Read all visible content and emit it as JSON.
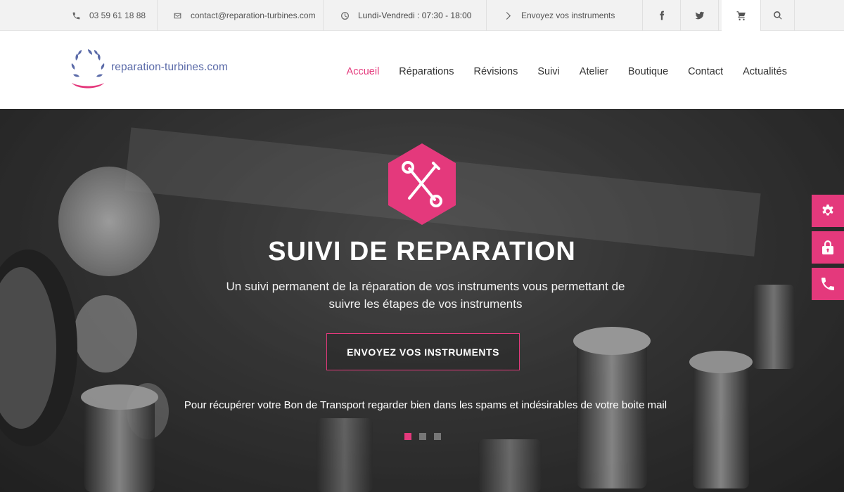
{
  "topbar": {
    "phone": "03 59 61 18 88",
    "email": "contact@reparation-turbines.com",
    "hours": "Lundi-Vendredi : 07:30 - 18:00",
    "send_link": "Envoyez vos instruments",
    "icons": [
      "phone-icon",
      "mail-icon",
      "clock-icon",
      "chevron-right-icon",
      "facebook-icon",
      "twitter-icon",
      "cart-icon",
      "search-icon"
    ]
  },
  "header": {
    "logo_text": "reparation-turbines.com",
    "nav": [
      {
        "label": "Accueil",
        "active": true
      },
      {
        "label": "Réparations"
      },
      {
        "label": "Révisions"
      },
      {
        "label": "Suivi"
      },
      {
        "label": "Atelier"
      },
      {
        "label": "Boutique"
      },
      {
        "label": "Contact"
      },
      {
        "label": "Actualités"
      }
    ]
  },
  "hero": {
    "icon": "tools-icon",
    "title": "SUIVI DE REPARATION",
    "subtitle": "Un suivi permanent de la réparation de vos instruments vous permettant de suivre les étapes de vos instruments",
    "cta_label": "ENVOYEZ VOS INSTRUMENTS",
    "notice": "Pour récupérer votre Bon de Transport regarder bien dans les spams et indésirables de votre boite mail",
    "slides_total": 3,
    "active_slide": 1
  },
  "side_widgets": [
    "gear-icon",
    "lock-icon",
    "phone-icon"
  ],
  "colors": {
    "accent": "#e4397c",
    "logo_blue": "#5a6aa8",
    "topbar_bg": "#f2f2f2"
  }
}
